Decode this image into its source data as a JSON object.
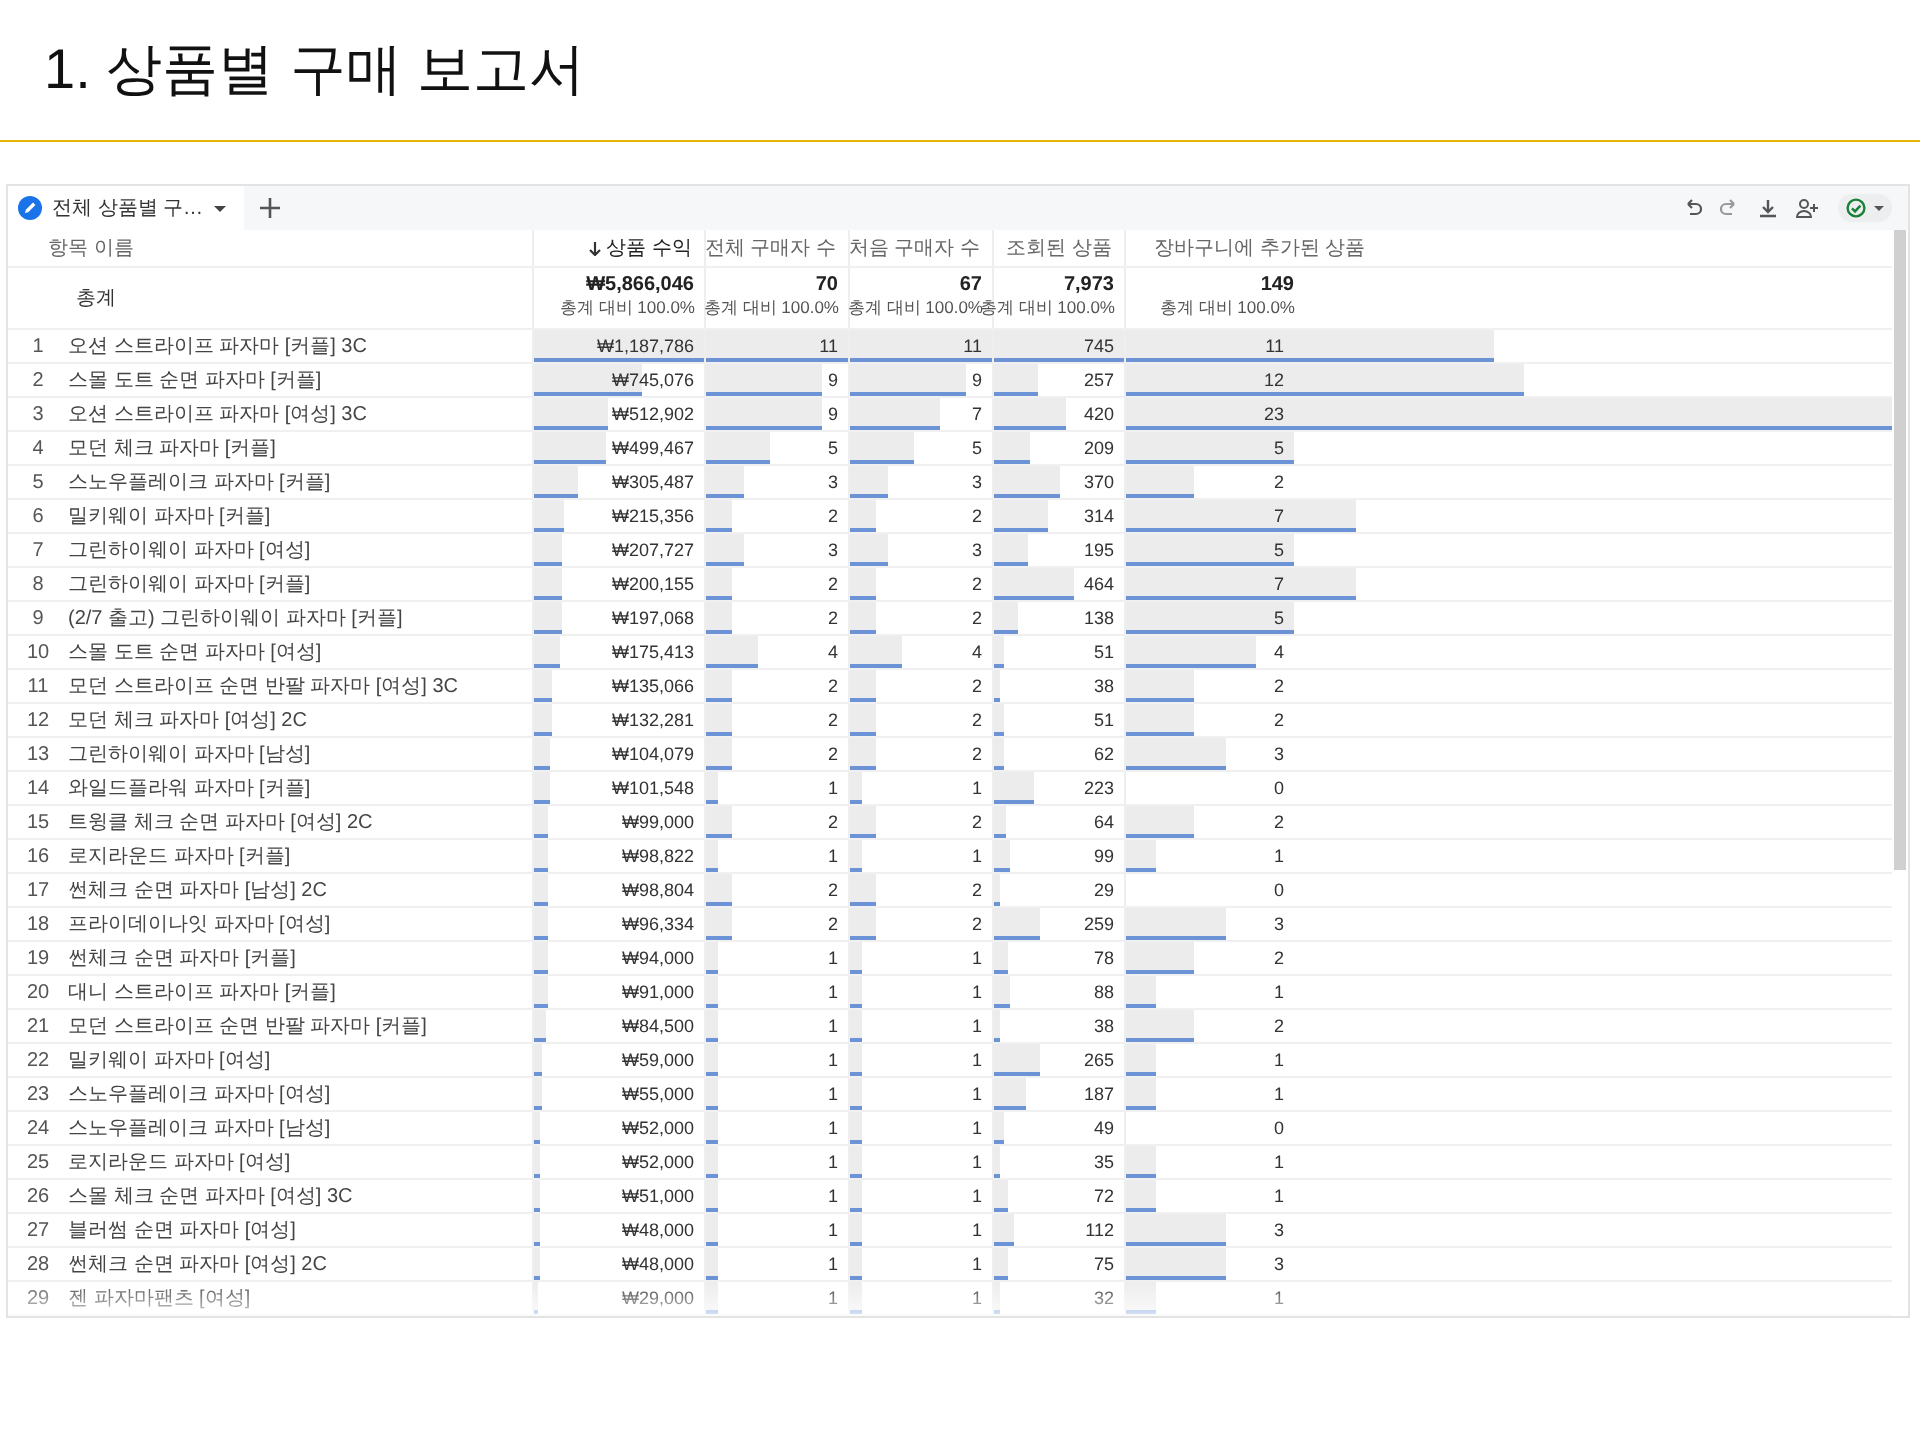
{
  "slide": {
    "title": "1. 상품별 구매 보고서"
  },
  "report": {
    "tabs": [
      {
        "label": "전체 상품별 구…",
        "selected": true
      }
    ],
    "columns": [
      {
        "label": "항목 이름",
        "sorted": false
      },
      {
        "label": "상품 수익",
        "sorted": true
      },
      {
        "label": "전체 구매자 수",
        "sorted": false
      },
      {
        "label": "처음 구매자 수",
        "sorted": false
      },
      {
        "label": "조회된 상품",
        "sorted": false
      },
      {
        "label": "장바구니에 추가된 상품",
        "sorted": false
      }
    ],
    "total": {
      "cells": [
        {
          "value": "총계"
        },
        {
          "value": "₩5,866,046",
          "share": "총계 대비 100.0%"
        },
        {
          "value": "70",
          "share": "총계 대비 100.0%"
        },
        {
          "value": "67",
          "share": "총계 대비 100.0%"
        },
        {
          "value": "7,973",
          "share": "총계 대비 100.0%"
        },
        {
          "value": "149",
          "share": "총계 대비 100.0%"
        }
      ]
    },
    "rows": [
      {
        "rank": "1",
        "cells": [
          {
            "value": "오션 스트라이프 파자마 [커플] 3C"
          },
          {
            "value": "₩1,187,786",
            "level": 1
          },
          {
            "value": "11",
            "level": 1
          },
          {
            "value": "11",
            "level": 1
          },
          {
            "value": "745",
            "level": 1
          },
          {
            "value": "11",
            "level": 0.48
          }
        ]
      },
      {
        "rank": "2",
        "cells": [
          {
            "value": "스몰 도트 순면 파자마 [커플]"
          },
          {
            "value": "₩745,076",
            "level": 0.63
          },
          {
            "value": "9",
            "level": 0.82
          },
          {
            "value": "9",
            "level": 0.82
          },
          {
            "value": "257",
            "level": 0.34
          },
          {
            "value": "12",
            "level": 0.52
          }
        ]
      },
      {
        "rank": "3",
        "cells": [
          {
            "value": "오션 스트라이프 파자마 [여성] 3C"
          },
          {
            "value": "₩512,902",
            "level": 0.43
          },
          {
            "value": "9",
            "level": 0.82
          },
          {
            "value": "7",
            "level": 0.64
          },
          {
            "value": "420",
            "level": 0.56
          },
          {
            "value": "23",
            "level": 1
          }
        ]
      },
      {
        "rank": "4",
        "cells": [
          {
            "value": "모던 체크 파자마 [커플]"
          },
          {
            "value": "₩499,467",
            "level": 0.42
          },
          {
            "value": "5",
            "level": 0.45
          },
          {
            "value": "5",
            "level": 0.45
          },
          {
            "value": "209",
            "level": 0.28
          },
          {
            "value": "5",
            "level": 0.22
          }
        ]
      },
      {
        "rank": "5",
        "cells": [
          {
            "value": "스노우플레이크 파자마 [커플]"
          },
          {
            "value": "₩305,487",
            "level": 0.26
          },
          {
            "value": "3",
            "level": 0.27
          },
          {
            "value": "3",
            "level": 0.27
          },
          {
            "value": "370",
            "level": 0.5
          },
          {
            "value": "2",
            "level": 0.09
          }
        ]
      },
      {
        "rank": "6",
        "cells": [
          {
            "value": "밀키웨이 파자마 [커플]"
          },
          {
            "value": "₩215,356",
            "level": 0.18
          },
          {
            "value": "2",
            "level": 0.18
          },
          {
            "value": "2",
            "level": 0.18
          },
          {
            "value": "314",
            "level": 0.42
          },
          {
            "value": "7",
            "level": 0.3
          }
        ]
      },
      {
        "rank": "7",
        "cells": [
          {
            "value": "그린하이웨이 파자마 [여성]"
          },
          {
            "value": "₩207,727",
            "level": 0.17
          },
          {
            "value": "3",
            "level": 0.27
          },
          {
            "value": "3",
            "level": 0.27
          },
          {
            "value": "195",
            "level": 0.26
          },
          {
            "value": "5",
            "level": 0.22
          }
        ]
      },
      {
        "rank": "8",
        "cells": [
          {
            "value": "그린하이웨이 파자마 [커플]"
          },
          {
            "value": "₩200,155",
            "level": 0.17
          },
          {
            "value": "2",
            "level": 0.18
          },
          {
            "value": "2",
            "level": 0.18
          },
          {
            "value": "464",
            "level": 0.62
          },
          {
            "value": "7",
            "level": 0.3
          }
        ]
      },
      {
        "rank": "9",
        "cells": [
          {
            "value": "(2/7 출고) 그린하이웨이 파자마 [커플]"
          },
          {
            "value": "₩197,068",
            "level": 0.17
          },
          {
            "value": "2",
            "level": 0.18
          },
          {
            "value": "2",
            "level": 0.18
          },
          {
            "value": "138",
            "level": 0.19
          },
          {
            "value": "5",
            "level": 0.22
          }
        ]
      },
      {
        "rank": "10",
        "cells": [
          {
            "value": "스몰 도트 순면 파자마 [여성]"
          },
          {
            "value": "₩175,413",
            "level": 0.15
          },
          {
            "value": "4",
            "level": 0.36
          },
          {
            "value": "4",
            "level": 0.36
          },
          {
            "value": "51",
            "level": 0.07
          },
          {
            "value": "4",
            "level": 0.17
          }
        ]
      },
      {
        "rank": "11",
        "cells": [
          {
            "value": "모던 스트라이프 순면 반팔 파자마 [여성] 3C"
          },
          {
            "value": "₩135,066",
            "level": 0.11
          },
          {
            "value": "2",
            "level": 0.18
          },
          {
            "value": "2",
            "level": 0.18
          },
          {
            "value": "38",
            "level": 0.05
          },
          {
            "value": "2",
            "level": 0.09
          }
        ]
      },
      {
        "rank": "12",
        "cells": [
          {
            "value": "모던 체크 파자마 [여성] 2C"
          },
          {
            "value": "₩132,281",
            "level": 0.11
          },
          {
            "value": "2",
            "level": 0.18
          },
          {
            "value": "2",
            "level": 0.18
          },
          {
            "value": "51",
            "level": 0.07
          },
          {
            "value": "2",
            "level": 0.09
          }
        ]
      },
      {
        "rank": "13",
        "cells": [
          {
            "value": "그린하이웨이 파자마 [남성]"
          },
          {
            "value": "₩104,079",
            "level": 0.09
          },
          {
            "value": "2",
            "level": 0.18
          },
          {
            "value": "2",
            "level": 0.18
          },
          {
            "value": "62",
            "level": 0.08
          },
          {
            "value": "3",
            "level": 0.13
          }
        ]
      },
      {
        "rank": "14",
        "cells": [
          {
            "value": "와일드플라워 파자마 [커플]"
          },
          {
            "value": "₩101,548",
            "level": 0.09
          },
          {
            "value": "1",
            "level": 0.09
          },
          {
            "value": "1",
            "level": 0.09
          },
          {
            "value": "223",
            "level": 0.3
          },
          {
            "value": "0"
          }
        ]
      },
      {
        "rank": "15",
        "cells": [
          {
            "value": "트윙클 체크 순면 파자마 [여성] 2C"
          },
          {
            "value": "₩99,000",
            "level": 0.08
          },
          {
            "value": "2",
            "level": 0.18
          },
          {
            "value": "2",
            "level": 0.18
          },
          {
            "value": "64",
            "level": 0.09
          },
          {
            "value": "2",
            "level": 0.09
          }
        ]
      },
      {
        "rank": "16",
        "cells": [
          {
            "value": "로지라운드 파자마 [커플]"
          },
          {
            "value": "₩98,822",
            "level": 0.08
          },
          {
            "value": "1",
            "level": 0.09
          },
          {
            "value": "1",
            "level": 0.09
          },
          {
            "value": "99",
            "level": 0.13
          },
          {
            "value": "1",
            "level": 0.04
          }
        ]
      },
      {
        "rank": "17",
        "cells": [
          {
            "value": "썬체크 순면 파자마 [남성] 2C"
          },
          {
            "value": "₩98,804",
            "level": 0.08
          },
          {
            "value": "2",
            "level": 0.18
          },
          {
            "value": "2",
            "level": 0.18
          },
          {
            "value": "29",
            "level": 0.04
          },
          {
            "value": "0"
          }
        ]
      },
      {
        "rank": "18",
        "cells": [
          {
            "value": "프라이데이나잇 파자마 [여성]"
          },
          {
            "value": "₩96,334",
            "level": 0.08
          },
          {
            "value": "2",
            "level": 0.18
          },
          {
            "value": "2",
            "level": 0.18
          },
          {
            "value": "259",
            "level": 0.35
          },
          {
            "value": "3",
            "level": 0.13
          }
        ]
      },
      {
        "rank": "19",
        "cells": [
          {
            "value": "썬체크 순면 파자마 [커플]"
          },
          {
            "value": "₩94,000",
            "level": 0.08
          },
          {
            "value": "1",
            "level": 0.09
          },
          {
            "value": "1",
            "level": 0.09
          },
          {
            "value": "78",
            "level": 0.1
          },
          {
            "value": "2",
            "level": 0.09
          }
        ]
      },
      {
        "rank": "20",
        "cells": [
          {
            "value": "대니 스트라이프 파자마 [커플]"
          },
          {
            "value": "₩91,000",
            "level": 0.08
          },
          {
            "value": "1",
            "level": 0.09
          },
          {
            "value": "1",
            "level": 0.09
          },
          {
            "value": "88",
            "level": 0.12
          },
          {
            "value": "1",
            "level": 0.04
          }
        ]
      },
      {
        "rank": "21",
        "cells": [
          {
            "value": "모던 스트라이프 순면 반팔 파자마 [커플]"
          },
          {
            "value": "₩84,500",
            "level": 0.07
          },
          {
            "value": "1",
            "level": 0.09
          },
          {
            "value": "1",
            "level": 0.09
          },
          {
            "value": "38",
            "level": 0.05
          },
          {
            "value": "2",
            "level": 0.09
          }
        ]
      },
      {
        "rank": "22",
        "cells": [
          {
            "value": "밀키웨이 파자마 [여성]"
          },
          {
            "value": "₩59,000",
            "level": 0.05
          },
          {
            "value": "1",
            "level": 0.09
          },
          {
            "value": "1",
            "level": 0.09
          },
          {
            "value": "265",
            "level": 0.36
          },
          {
            "value": "1",
            "level": 0.04
          }
        ]
      },
      {
        "rank": "23",
        "cells": [
          {
            "value": "스노우플레이크 파자마 [여성]"
          },
          {
            "value": "₩55,000",
            "level": 0.05
          },
          {
            "value": "1",
            "level": 0.09
          },
          {
            "value": "1",
            "level": 0.09
          },
          {
            "value": "187",
            "level": 0.25
          },
          {
            "value": "1",
            "level": 0.04
          }
        ]
      },
      {
        "rank": "24",
        "cells": [
          {
            "value": "스노우플레이크 파자마 [남성]"
          },
          {
            "value": "₩52,000",
            "level": 0.04
          },
          {
            "value": "1",
            "level": 0.09
          },
          {
            "value": "1",
            "level": 0.09
          },
          {
            "value": "49",
            "level": 0.07
          },
          {
            "value": "0"
          }
        ]
      },
      {
        "rank": "25",
        "cells": [
          {
            "value": "로지라운드 파자마 [여성]"
          },
          {
            "value": "₩52,000",
            "level": 0.04
          },
          {
            "value": "1",
            "level": 0.09
          },
          {
            "value": "1",
            "level": 0.09
          },
          {
            "value": "35",
            "level": 0.05
          },
          {
            "value": "1",
            "level": 0.04
          }
        ]
      },
      {
        "rank": "26",
        "cells": [
          {
            "value": "스몰 체크 순면 파자마 [여성] 3C"
          },
          {
            "value": "₩51,000",
            "level": 0.04
          },
          {
            "value": "1",
            "level": 0.09
          },
          {
            "value": "1",
            "level": 0.09
          },
          {
            "value": "72",
            "level": 0.1
          },
          {
            "value": "1",
            "level": 0.04
          }
        ]
      },
      {
        "rank": "27",
        "cells": [
          {
            "value": "블러썸 순면 파자마 [여성]"
          },
          {
            "value": "₩48,000",
            "level": 0.04
          },
          {
            "value": "1",
            "level": 0.09
          },
          {
            "value": "1",
            "level": 0.09
          },
          {
            "value": "112",
            "level": 0.15
          },
          {
            "value": "3",
            "level": 0.13
          }
        ]
      },
      {
        "rank": "28",
        "cells": [
          {
            "value": "썬체크 순면 파자마 [여성] 2C"
          },
          {
            "value": "₩48,000",
            "level": 0.04
          },
          {
            "value": "1",
            "level": 0.09
          },
          {
            "value": "1",
            "level": 0.09
          },
          {
            "value": "75",
            "level": 0.1
          },
          {
            "value": "3",
            "level": 0.13
          }
        ]
      },
      {
        "rank": "29",
        "cells": [
          {
            "value": "젠 파자마팬츠 [여성]"
          },
          {
            "value": "₩29,000",
            "level": 0.02
          },
          {
            "value": "1",
            "level": 0.09
          },
          {
            "value": "1",
            "level": 0.09
          },
          {
            "value": "32",
            "level": 0.04
          },
          {
            "value": "1",
            "level": 0.04
          }
        ]
      }
    ]
  }
}
